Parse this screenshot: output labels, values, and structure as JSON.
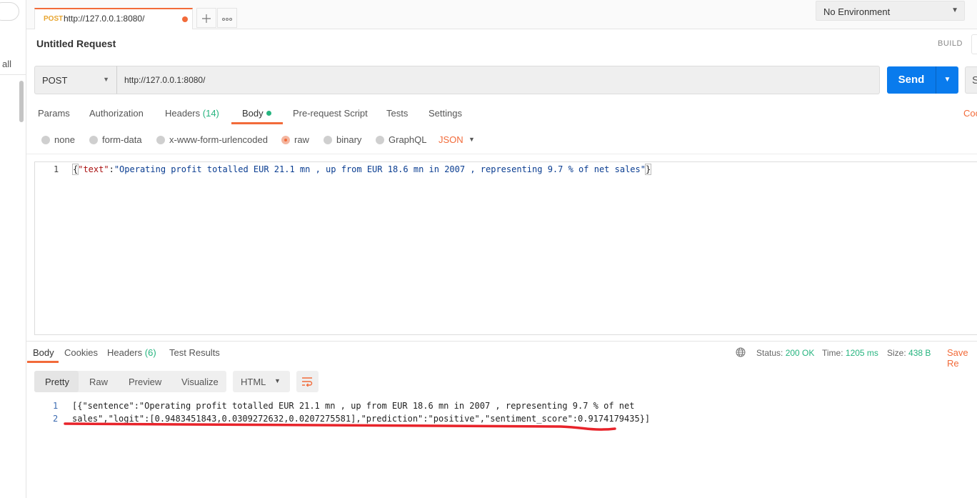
{
  "sidebar": {
    "filter_label": "all"
  },
  "tabs": {
    "active": {
      "method": "POST",
      "url": "http://127.0.0.1:8080/"
    },
    "add_icon": "plus-icon",
    "more_icon": "ellipsis-icon"
  },
  "environment": {
    "selected": "No Environment"
  },
  "request": {
    "title": "Untitled Request",
    "build_label": "BUILD",
    "method": "POST",
    "url": "http://127.0.0.1:8080/",
    "send_label": "Send",
    "save_edge_label": "S"
  },
  "request_tabs": {
    "params": "Params",
    "authorization": "Authorization",
    "headers": "Headers",
    "headers_count": "(14)",
    "body": "Body",
    "pre_request": "Pre-request Script",
    "tests": "Tests",
    "settings": "Settings",
    "cookies_edge": "Coo"
  },
  "body_types": {
    "none": "none",
    "form_data": "form-data",
    "urlencoded": "x-www-form-urlencoded",
    "raw": "raw",
    "binary": "binary",
    "graphql": "GraphQL",
    "format": "JSON"
  },
  "editor": {
    "line_number": "1",
    "open_brace": "{",
    "key": "\"text\"",
    "colon": ":",
    "value": "\"Operating profit totalled EUR 21.1 mn , up from EUR 18.6 mn in 2007 , representing 9.7 % of net sales\"",
    "close_brace": "}"
  },
  "response_tabs": {
    "body": "Body",
    "cookies": "Cookies",
    "headers": "Headers",
    "headers_count": "(6)",
    "test_results": "Test Results"
  },
  "response_meta": {
    "status_label": "Status:",
    "status_value": "200 OK",
    "time_label": "Time:",
    "time_value": "1205 ms",
    "size_label": "Size:",
    "size_value": "438 B",
    "save_label": "Save Re"
  },
  "response_view": {
    "pretty": "Pretty",
    "raw": "Raw",
    "preview": "Preview",
    "visualize": "Visualize",
    "format": "HTML"
  },
  "response_body": {
    "line1_number": "1",
    "line1": "[{\"sentence\":\"Operating profit totalled EUR 21.1 mn , up from EUR 18.6 mn in 2007 , representing 9.7 % of net",
    "line2_number": "2",
    "line2": "sales\",\"logit\":[0.9483451843,0.0309272632,0.0207275581],\"prediction\":\"positive\",\"sentiment_score\":0.9174179435}]"
  },
  "colors": {
    "accent": "#f26b3a",
    "send_button": "#097bed",
    "success": "#26b47f",
    "annotation": "#e8232a"
  }
}
